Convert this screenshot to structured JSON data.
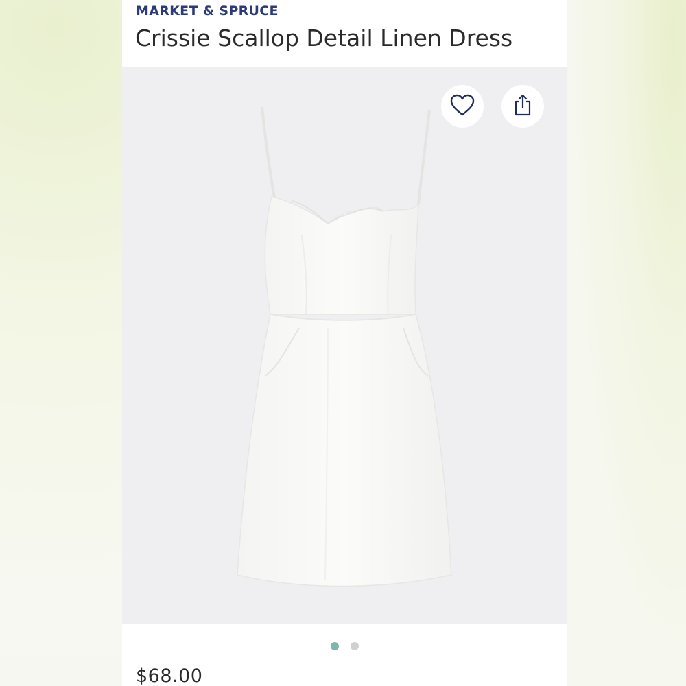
{
  "product": {
    "brand": "MARKET & SPRUCE",
    "title": "Crissie Scallop Detail Linen Dress",
    "price": "$68.00"
  },
  "image_actions": [
    {
      "icon": "heart-outline-icon"
    },
    {
      "icon": "share-icon"
    }
  ],
  "carousel": {
    "total": 2,
    "active_index": 0
  },
  "colors": {
    "brand_text": "#2b3a78",
    "image_bg": "#efeff1",
    "active_dot": "#7fb5ad",
    "inactive_dot": "#d0d0d3"
  }
}
